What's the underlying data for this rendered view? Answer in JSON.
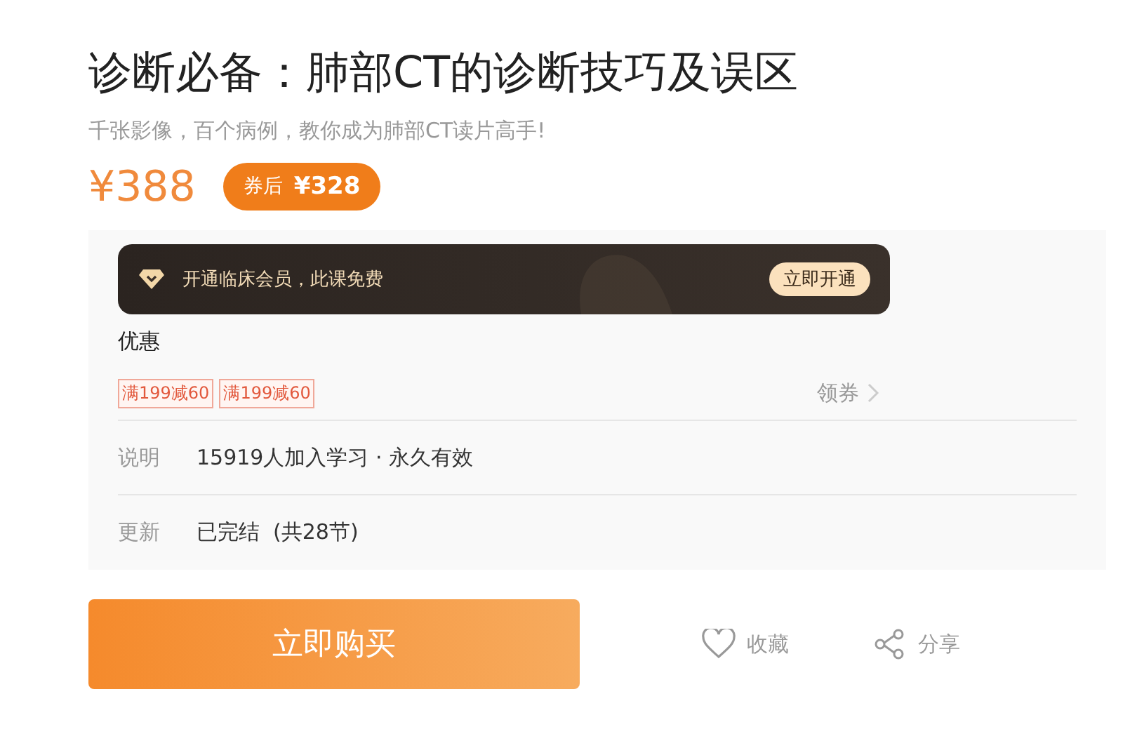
{
  "title": "诊断必备：肺部CT的诊断技巧及误区",
  "subtitle": "千张影像，百个病例，教你成为肺部CT读片高手!",
  "price": "¥388",
  "coupon_price": {
    "label": "券后",
    "amount": "¥328"
  },
  "member_banner": {
    "text": "开通临床会员，此课免费",
    "button": "立即开通"
  },
  "discount": {
    "label": "优惠",
    "coupons": [
      "满199减60",
      "满199减60"
    ],
    "claim": "领券"
  },
  "info_rows": [
    {
      "label": "说明",
      "value": "15919人加入学习 · 永久有效"
    },
    {
      "label": "更新",
      "value": "已完结  (共28节)"
    }
  ],
  "buy_button": "立即购买",
  "actions": [
    {
      "kind": "favorite",
      "label": "收藏"
    },
    {
      "kind": "share",
      "label": "分享"
    }
  ]
}
